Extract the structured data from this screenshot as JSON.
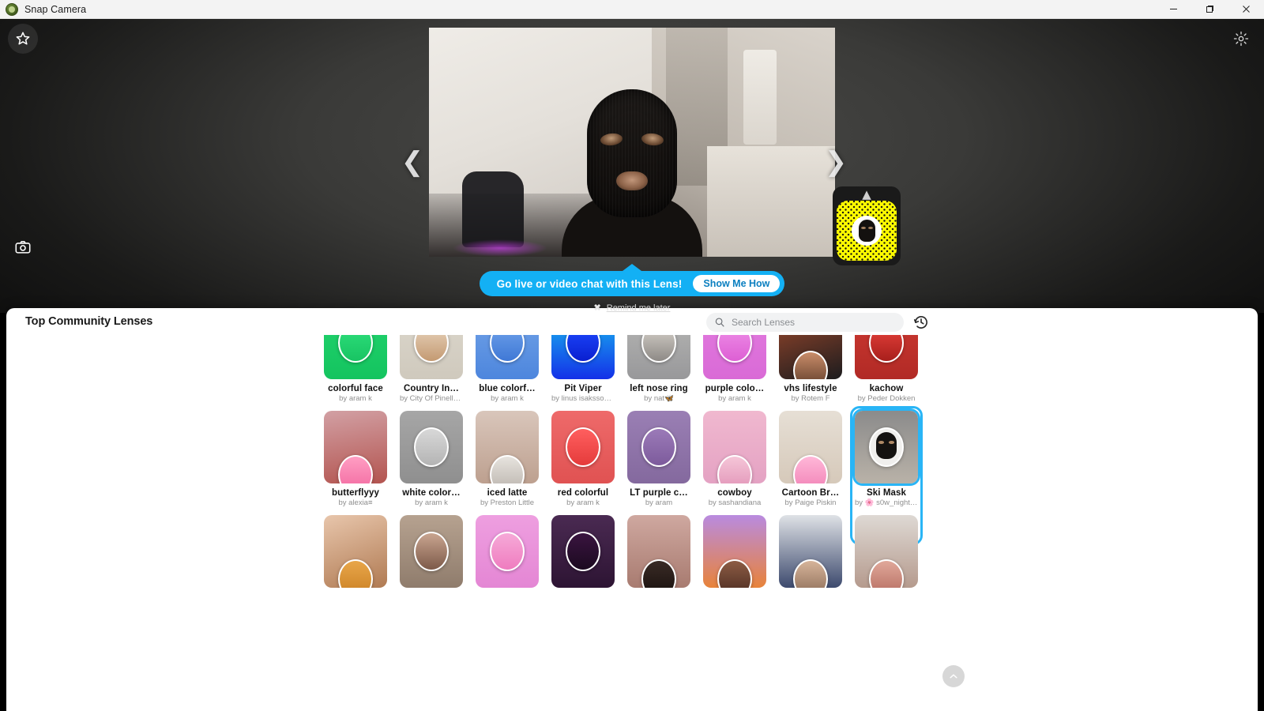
{
  "window": {
    "title": "Snap Camera",
    "app_icon": "snap-camera-app-icon",
    "minimize_label": "Minimize",
    "maximize_label": "Maximize",
    "close_label": "Close"
  },
  "stage": {
    "favorite_icon": "star-icon",
    "capture_icon": "camera-icon",
    "settings_icon": "gear-icon",
    "prev_icon": "chevron-left-icon",
    "next_icon": "chevron-right-icon",
    "snapcode_collapse_icon": "chevron-up-icon",
    "snapcode_label": "snapcode"
  },
  "tooltip": {
    "message": "Go live or video chat with this Lens!",
    "cta": "Show Me How",
    "dismiss_icon": "close-x-icon",
    "dismiss_label": "Remind me later"
  },
  "drawer": {
    "title": "Top Community Lenses",
    "search": {
      "icon": "search-icon",
      "value": "",
      "placeholder": "Search Lenses"
    },
    "history_icon": "history-clock-icon",
    "scroll_top_icon": "chevron-up-icon",
    "rows": [
      {
        "clipped": true,
        "tiles": [
          {
            "name": "colorful face",
            "by": "by aram k",
            "bg": "linear-gradient(180deg,#22d46e,#14c45f)",
            "badge": "linear-gradient(180deg,#2fe07c,#18c463)",
            "badge_pos": "center"
          },
          {
            "name": "Country In…",
            "by": "by City Of Pinella…",
            "bg": "linear-gradient(180deg,#ddd8cd,#cfc9bd)",
            "badge": "linear-gradient(180deg,#e8d4bd,#c49a72)",
            "badge_pos": "center"
          },
          {
            "name": "blue colorf…",
            "by": "by aram k",
            "bg": "linear-gradient(180deg,#74a4e8,#4d86dd)",
            "badge": "linear-gradient(180deg,#6fa2ea,#3f78d6)",
            "badge_pos": "center"
          },
          {
            "name": "Pit Viper",
            "by": "by linus isaksson 🏂",
            "bg": "linear-gradient(180deg,#18c8f0,#1430e8)",
            "badge": "linear-gradient(180deg,#1e4bff,#0a1fd0)",
            "badge_pos": "center"
          },
          {
            "name": "left nose ring",
            "by": "by nat🦋",
            "bg": "linear-gradient(180deg,#b9b9b7,#98989a)",
            "badge": "linear-gradient(180deg,#d8d3cc,#8e8a86)",
            "badge_pos": "center"
          },
          {
            "name": "purple colo…",
            "by": "by aram k",
            "bg": "linear-gradient(180deg,#e37ce0,#d96ad6)",
            "badge": "linear-gradient(180deg,#ef8fe8,#dd5fd4)",
            "badge_pos": "center"
          },
          {
            "name": "vhs lifestyle",
            "by": "by Rotem F",
            "bg": "linear-gradient(160deg,#a0492c,#1c1c1e)",
            "badge": "linear-gradient(180deg,#c98d6a,#5d3a28)",
            "badge_pos": "low"
          },
          {
            "name": "kachow",
            "by": "by Peder Dokken",
            "bg": "linear-gradient(180deg,#cf3a33,#b12a25)",
            "badge": "linear-gradient(180deg,#e8423c,#a81f1c)",
            "badge_pos": "center"
          }
        ]
      },
      {
        "clipped": false,
        "tiles": [
          {
            "name": "butterflyyy",
            "by": "by alexia≡",
            "bg": "linear-gradient(170deg,#d2a0a4,#b3544f)",
            "badge": "linear-gradient(180deg,#ff9ec3,#f2679f)",
            "badge_pos": "low"
          },
          {
            "name": "white color…",
            "by": "by aram k",
            "bg": "linear-gradient(180deg,#a6a6a6,#8f8f8f)",
            "badge": "linear-gradient(180deg,#d8d8d8,#b4b4b4)",
            "badge_pos": "center"
          },
          {
            "name": "iced latte",
            "by": "by Preston Little",
            "bg": "linear-gradient(180deg,#d9c6bb,#bda08f)",
            "badge": "linear-gradient(180deg,#e7e3de,#b9b2ab)",
            "badge_pos": "low"
          },
          {
            "name": "red colorful",
            "by": "by aram k",
            "bg": "linear-gradient(180deg,#ee6a6a,#e05252)",
            "badge": "linear-gradient(180deg,#ff5f5f,#e53b3b)",
            "badge_pos": "center"
          },
          {
            "name": "LT purple c…",
            "by": "by aram",
            "bg": "linear-gradient(180deg,#9a7fb4,#84699e)",
            "badge": "linear-gradient(180deg,#9b7ab8,#7d5b9c)",
            "badge_pos": "center"
          },
          {
            "name": "cowboy",
            "by": "by sashandiana",
            "bg": "linear-gradient(180deg,#f0b8cf,#e4a2c3)",
            "badge": "linear-gradient(180deg,#f5c6d8,#e090b5)",
            "badge_pos": "low"
          },
          {
            "name": "Cartoon Br…",
            "by": "by Paige Piskin",
            "bg": "linear-gradient(180deg,#e6dfd5,#d6c9ba)",
            "badge": "linear-gradient(180deg,#ffb7d8,#f07fb4)",
            "badge_pos": "low"
          },
          {
            "name": "Ski Mask",
            "by": "by 🌸 s0w_night ◉",
            "bg": "linear-gradient(180deg,#8b8b8b,#b9b2a8)",
            "badge": "ski-mask",
            "badge_pos": "center",
            "selected": true
          }
        ]
      },
      {
        "clipped": true,
        "tiles": [
          {
            "name": "",
            "by": "",
            "bg": "linear-gradient(160deg,#e8c6ac,#b07a52)",
            "badge": "linear-gradient(180deg,#e8a64a,#c97f22)",
            "badge_pos": "low"
          },
          {
            "name": "",
            "by": "",
            "bg": "linear-gradient(180deg,#b6a290,#8f7c6c)",
            "badge": "linear-gradient(180deg,#c9a590,#7d5a49)",
            "badge_pos": "center"
          },
          {
            "name": "",
            "by": "",
            "bg": "linear-gradient(180deg,#ee9fe0,#e486d4)",
            "badge": "linear-gradient(180deg,#f6a9d8,#ef7cbf)",
            "badge_pos": "center"
          },
          {
            "name": "",
            "by": "",
            "bg": "linear-gradient(180deg,#4a2a52,#2d1433)",
            "badge": "linear-gradient(180deg,#3a1440,#1c0a20)",
            "badge_pos": "center"
          },
          {
            "name": "",
            "by": "",
            "bg": "linear-gradient(180deg,#cfa8a0,#a87b70)",
            "badge": "linear-gradient(180deg,#3a2b26,#17100d)",
            "badge_pos": "low"
          },
          {
            "name": "",
            "by": "",
            "bg": "linear-gradient(180deg,#b98be0,#e8833a)",
            "badge": "linear-gradient(180deg,#8c5c44,#4a2a20)",
            "badge_pos": "low"
          },
          {
            "name": "",
            "by": "",
            "bg": "linear-gradient(180deg,#dfe2e6,#3d4a6e)",
            "badge": "linear-gradient(180deg,#d6b49a,#8a6a55)",
            "badge_pos": "low"
          },
          {
            "name": "",
            "by": "",
            "bg": "linear-gradient(180deg,#ded9d4,#b59a8d)",
            "badge": "linear-gradient(180deg,#e0a89a,#b46a5e)",
            "badge_pos": "low"
          }
        ]
      }
    ]
  },
  "colors": {
    "accent": "#29b5f6",
    "tooltip": "#13b0f4",
    "snapcode_yellow": "#fffc00",
    "drawer_bg": "#ffffff"
  }
}
